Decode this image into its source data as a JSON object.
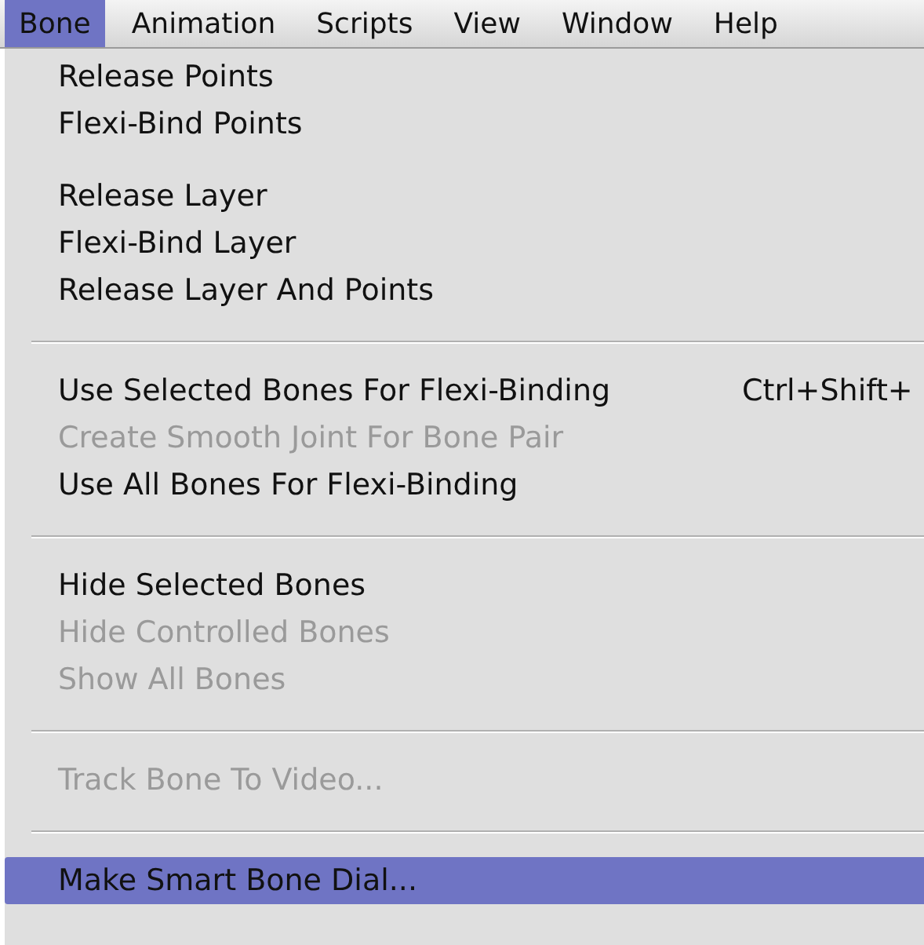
{
  "menu_bar": [
    {
      "label": "Bone",
      "selected": true
    },
    {
      "label": "Animation",
      "selected": false
    },
    {
      "label": "Scripts",
      "selected": false
    },
    {
      "label": "View",
      "selected": false
    },
    {
      "label": "Window",
      "selected": false
    },
    {
      "label": "Help",
      "selected": false
    }
  ],
  "menu": {
    "groups": [
      {
        "divider": false,
        "items": [
          {
            "label": "Release Points",
            "disabled": false,
            "selected": false
          },
          {
            "label": "Flexi-Bind Points",
            "disabled": false,
            "selected": false
          }
        ]
      },
      {
        "divider": false,
        "items": [
          {
            "label": "Release Layer",
            "disabled": false,
            "selected": false
          },
          {
            "label": "Flexi-Bind Layer",
            "disabled": false,
            "selected": false
          },
          {
            "label": "Release Layer And Points",
            "disabled": false,
            "selected": false
          }
        ]
      },
      {
        "divider": true,
        "items": [
          {
            "label": "Use Selected Bones For Flexi-Binding",
            "disabled": false,
            "selected": false,
            "shortcut": "Ctrl+Shift+"
          },
          {
            "label": "Create Smooth Joint For Bone Pair",
            "disabled": true,
            "selected": false
          },
          {
            "label": "Use All Bones For Flexi-Binding",
            "disabled": false,
            "selected": false
          }
        ]
      },
      {
        "divider": true,
        "items": [
          {
            "label": "Hide Selected Bones",
            "disabled": false,
            "selected": false
          },
          {
            "label": "Hide Controlled Bones",
            "disabled": true,
            "selected": false
          },
          {
            "label": "Show All Bones",
            "disabled": true,
            "selected": false
          }
        ]
      },
      {
        "divider": true,
        "items": [
          {
            "label": "Track Bone To Video...",
            "disabled": true,
            "selected": false
          }
        ]
      },
      {
        "divider": true,
        "items": [
          {
            "label": "Make Smart Bone Dial...",
            "disabled": false,
            "selected": true
          }
        ]
      }
    ]
  }
}
